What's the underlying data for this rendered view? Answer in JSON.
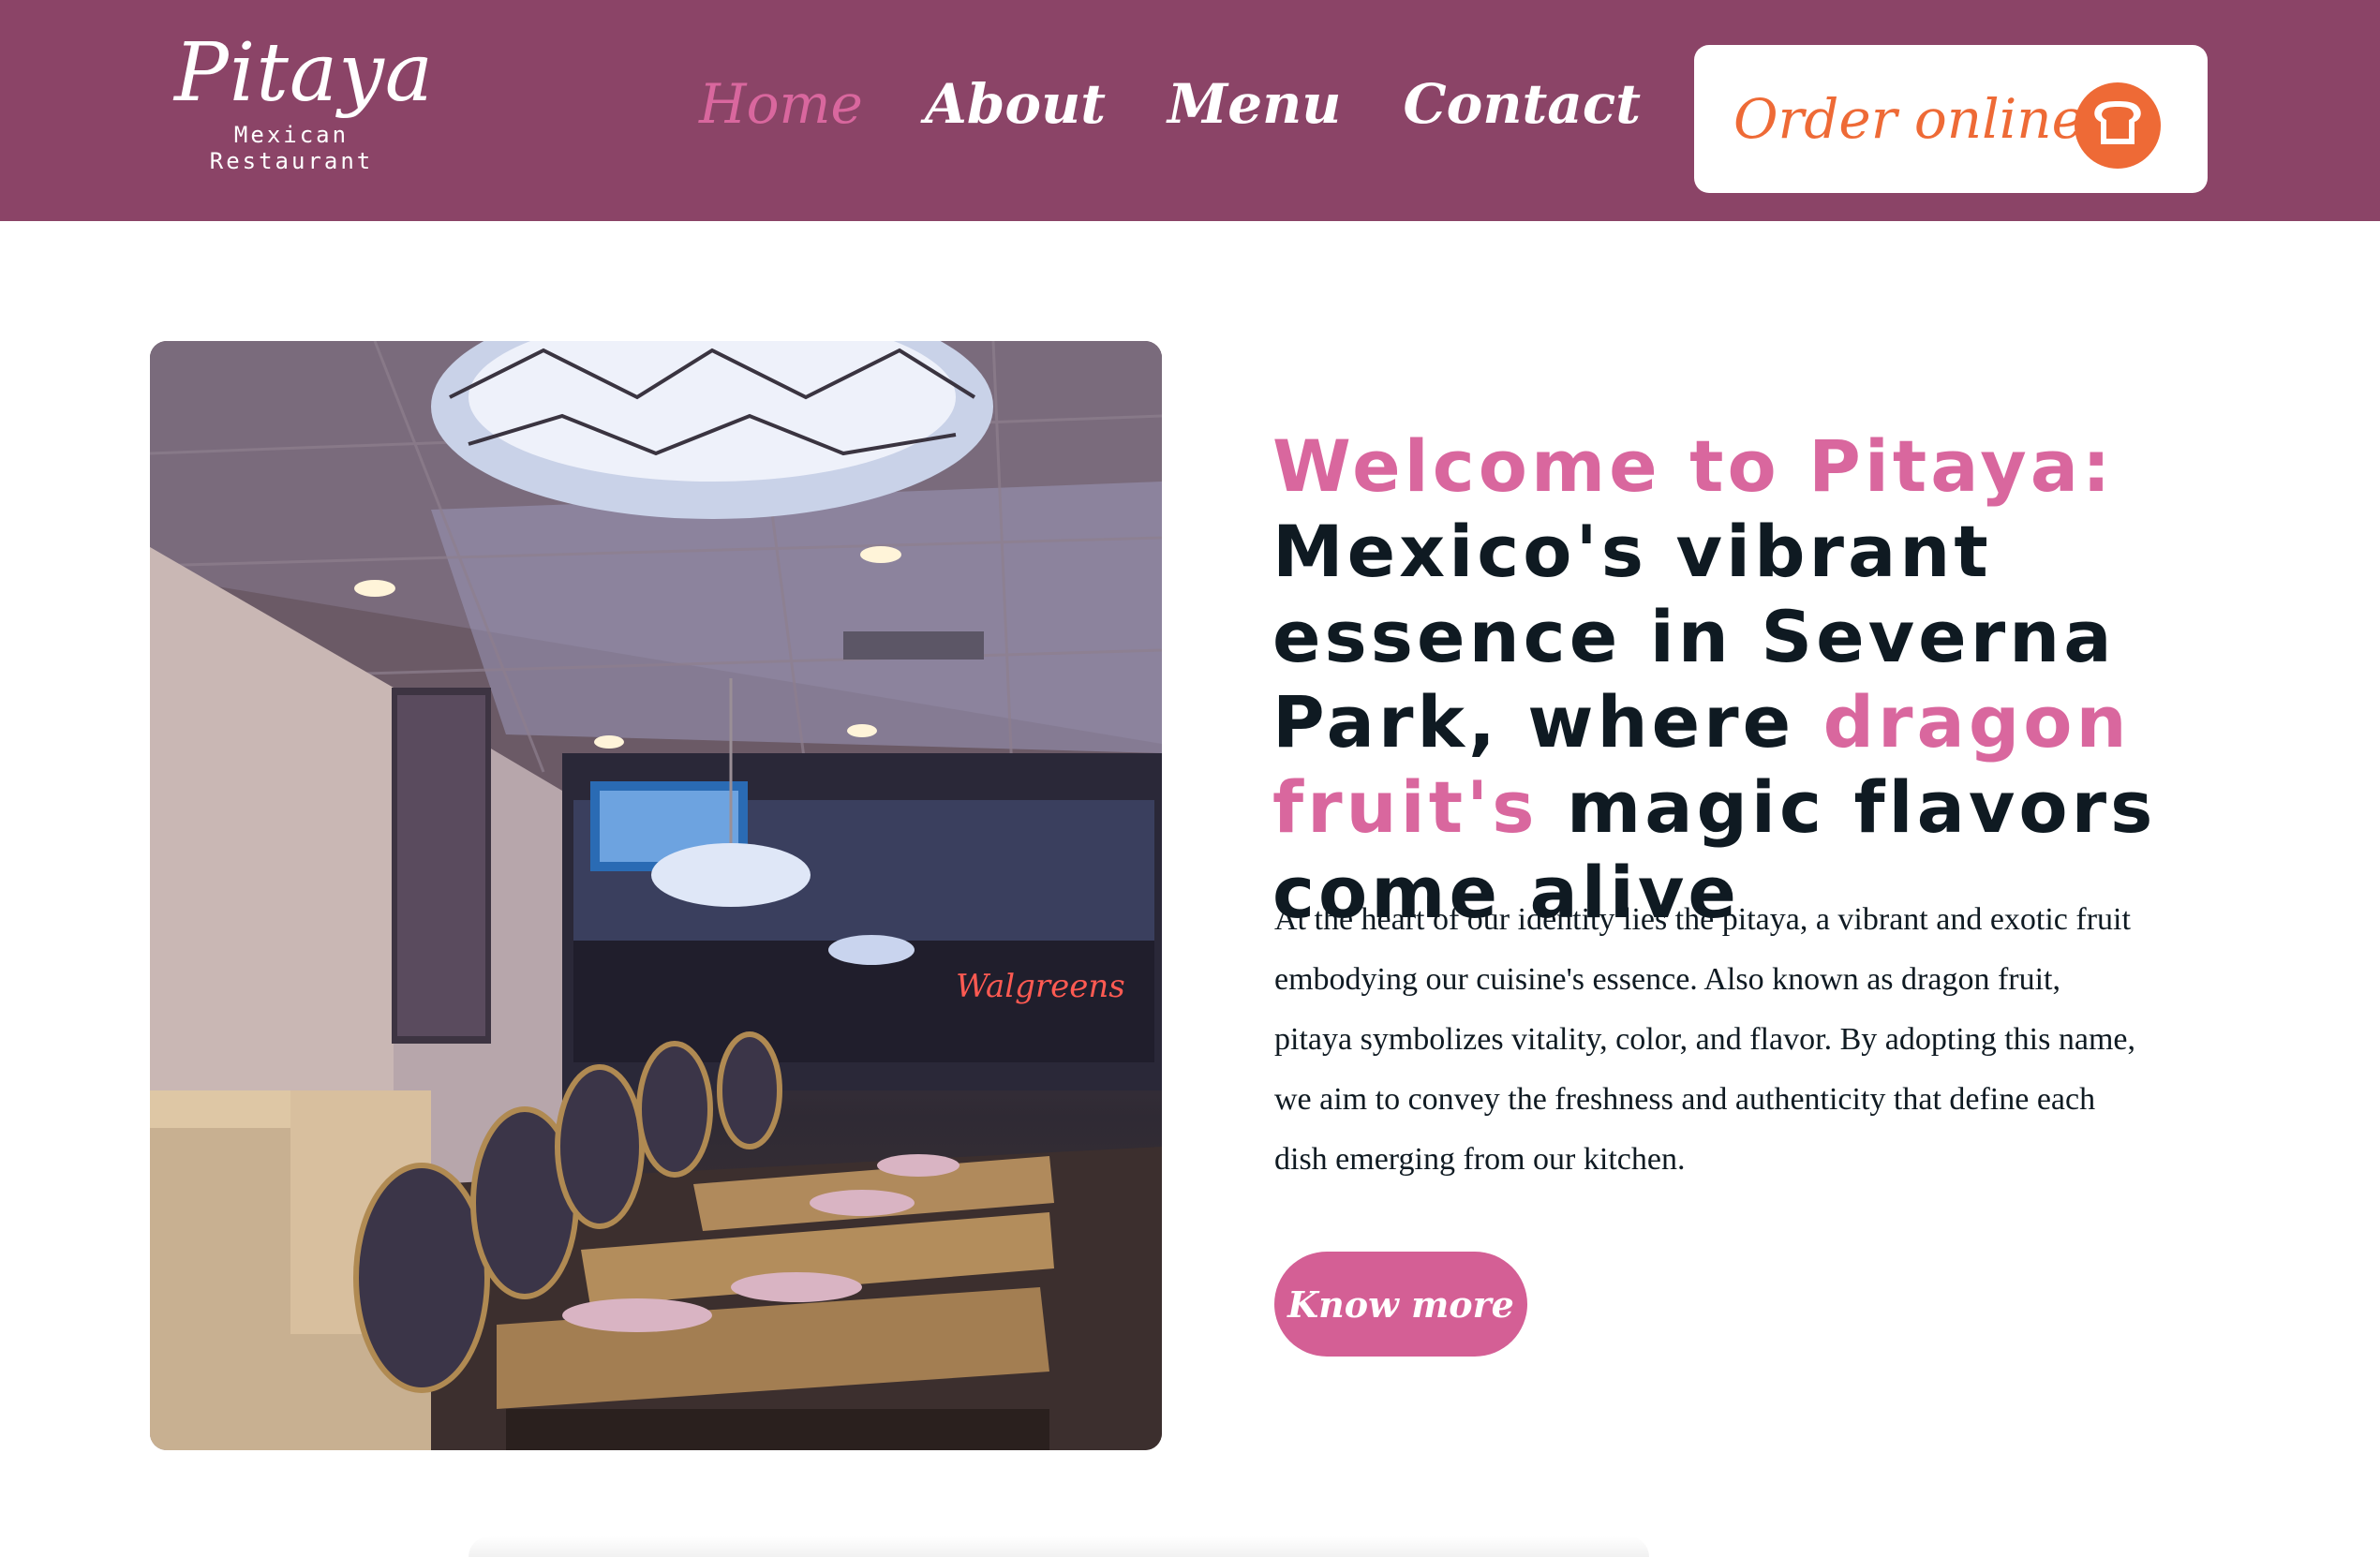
{
  "brand": {
    "name": "Pitaya",
    "tagline": "Mexican Restaurant"
  },
  "nav": {
    "items": [
      {
        "label": "Home",
        "active": true
      },
      {
        "label": "About",
        "active": false
      },
      {
        "label": "Menu",
        "active": false
      },
      {
        "label": "Contact",
        "active": false
      }
    ]
  },
  "order": {
    "label": "Order online",
    "icon": "toast-icon"
  },
  "hero": {
    "image_alt": "Restaurant dining room interior"
  },
  "headline": {
    "part1": "Welcome to Pitaya:",
    "part2": "Mexico's vibrant essence in Severna Park, where",
    "part3": "dragon fruit's",
    "part4": "magic flavors come alive"
  },
  "body": "At the heart of our identity lies the pitaya, a vibrant and exotic fruit embodying our cuisine's essence. Also known as dragon fruit, pitaya symbolizes vitality, color, and flavor. By adopting this name, we aim to convey the freshness and authenticity that define each dish emerging from our kitchen.",
  "cta": {
    "label": "Know more"
  },
  "colors": {
    "header_bg": "#8b4467",
    "accent_pink": "#d9679e",
    "order_orange": "#ee6a36",
    "text_dark": "#0f1a22"
  }
}
